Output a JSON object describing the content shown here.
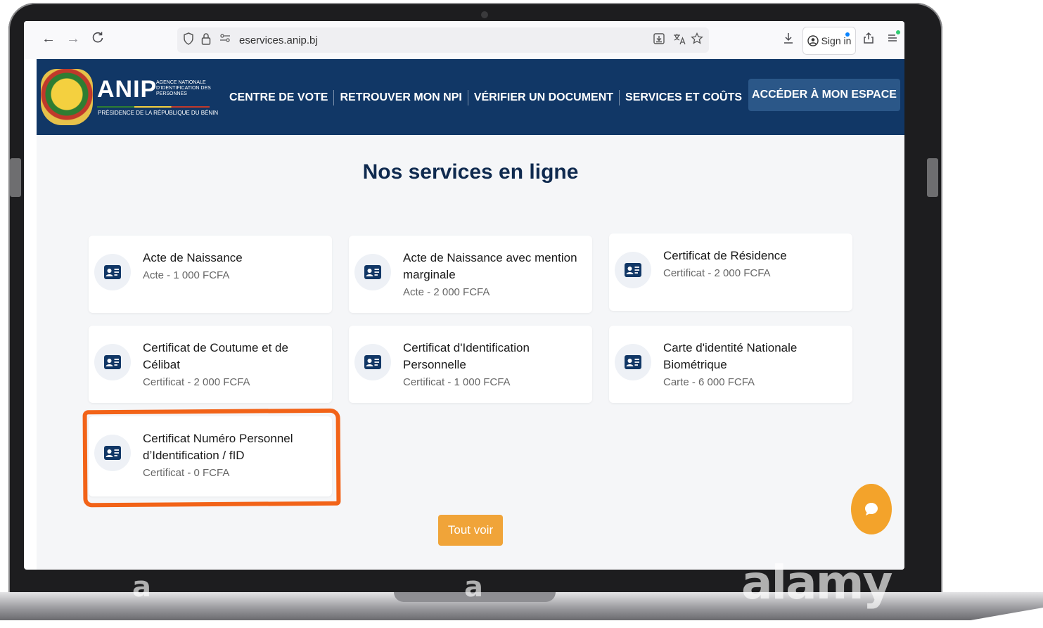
{
  "browser": {
    "back_icon": "←",
    "forward_icon": "→",
    "reload_icon": "C",
    "url_domain": "eservices.anip.bj",
    "sign_in": "Sign in"
  },
  "header": {
    "logo_title": "ANIP",
    "logo_subtitle": "AGENCE NATIONALE D'IDENTIFICATION DES PERSONNES",
    "logo_presidency": "PRÉSIDENCE DE LA RÉPUBLIQUE DU BÉNIN",
    "nav": [
      "CENTRE DE VOTE",
      "RETROUVER MON NPI",
      "VÉRIFIER UN DOCUMENT",
      "SERVICES ET COÛTS"
    ],
    "cta": "ACCÉDER À MON ESPACE"
  },
  "main": {
    "title": "Nos services en ligne",
    "services": [
      {
        "title": "Acte de Naissance",
        "subtitle": "Acte - 1 000 FCFA"
      },
      {
        "title": "Acte de Naissance avec mention marginale",
        "subtitle": "Acte - 2 000 FCFA"
      },
      {
        "title": "Certificat de Résidence",
        "subtitle": "Certificat - 2 000 FCFA"
      },
      {
        "title": "Certificat de Coutume et de Célibat",
        "subtitle": "Certificat - 2 000 FCFA"
      },
      {
        "title": "Certificat d'Identification Personnelle",
        "subtitle": "Certificat - 1 000 FCFA"
      },
      {
        "title": "Carte d'identité Nationale Biométrique",
        "subtitle": "Carte - 6 000 FCFA"
      },
      {
        "title": "Certificat Numéro Personnel d’Identification / fID",
        "subtitle": "Certificat - 0 FCFA"
      }
    ],
    "see_all": "Tout voir"
  },
  "watermark": {
    "small": "a",
    "brand": "alamy"
  },
  "colors": {
    "header_bg": "#113766",
    "cta_bg": "#2b5788",
    "see_all_bg": "#f0a439",
    "highlight": "#f26318",
    "chat_bg": "#f3a32b"
  },
  "icons": {
    "card": "id-card-icon",
    "chat": "chat-bubble-icon",
    "url": [
      "shield-icon",
      "lock-icon",
      "permissions-icon"
    ],
    "url_right": [
      "save-page-icon",
      "translate-icon",
      "bookmark-star-icon"
    ],
    "toolbar": [
      "download-icon",
      "account-icon",
      "share-icon",
      "menu-icon"
    ]
  }
}
